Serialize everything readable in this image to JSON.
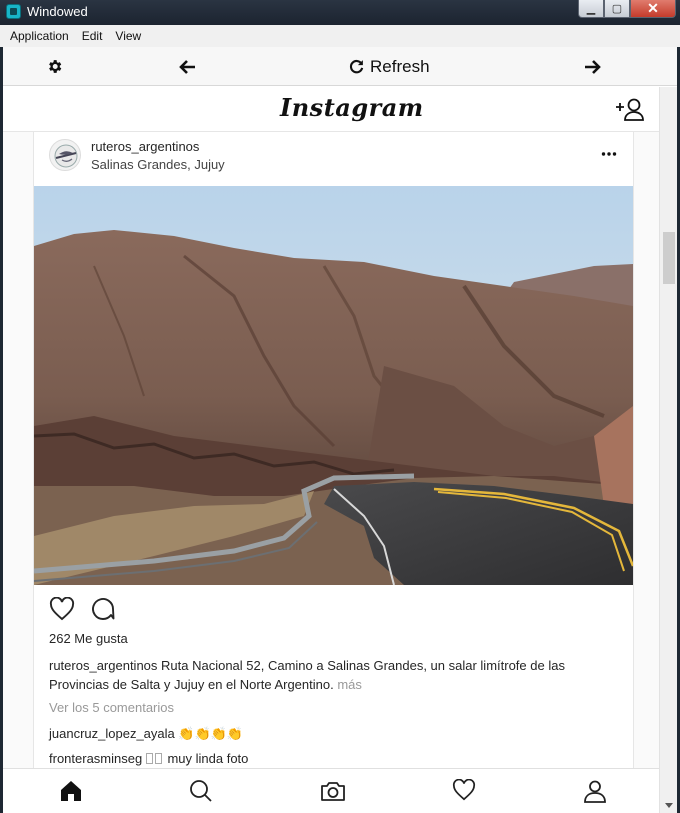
{
  "window": {
    "title": "Windowed"
  },
  "menu": {
    "items": [
      "Application",
      "Edit",
      "View"
    ]
  },
  "toolbar": {
    "refresh_label": "Refresh"
  },
  "header": {
    "logo": "Instagram"
  },
  "post": {
    "username": "ruteros_argentinos",
    "location": "Salinas Grandes, Jujuy",
    "likes": "262 Me gusta",
    "caption_user": "ruteros_argentinos",
    "caption_text": " Ruta Nacional 52, Camino a Salinas Grandes, un salar limítrofe de las Provincias de Salta y Jujuy en el Norte Argentino.",
    "caption_more": " más",
    "view_comments": "Ver los 5 comentarios",
    "comments": [
      {
        "user": "juancruz_lopez_ayala",
        "text": " 👏👏👏👏"
      },
      {
        "user": "fronterasminseg",
        "text": " muy linda foto"
      }
    ]
  },
  "colors": {
    "link_gray": "#999999",
    "text": "#262626"
  }
}
